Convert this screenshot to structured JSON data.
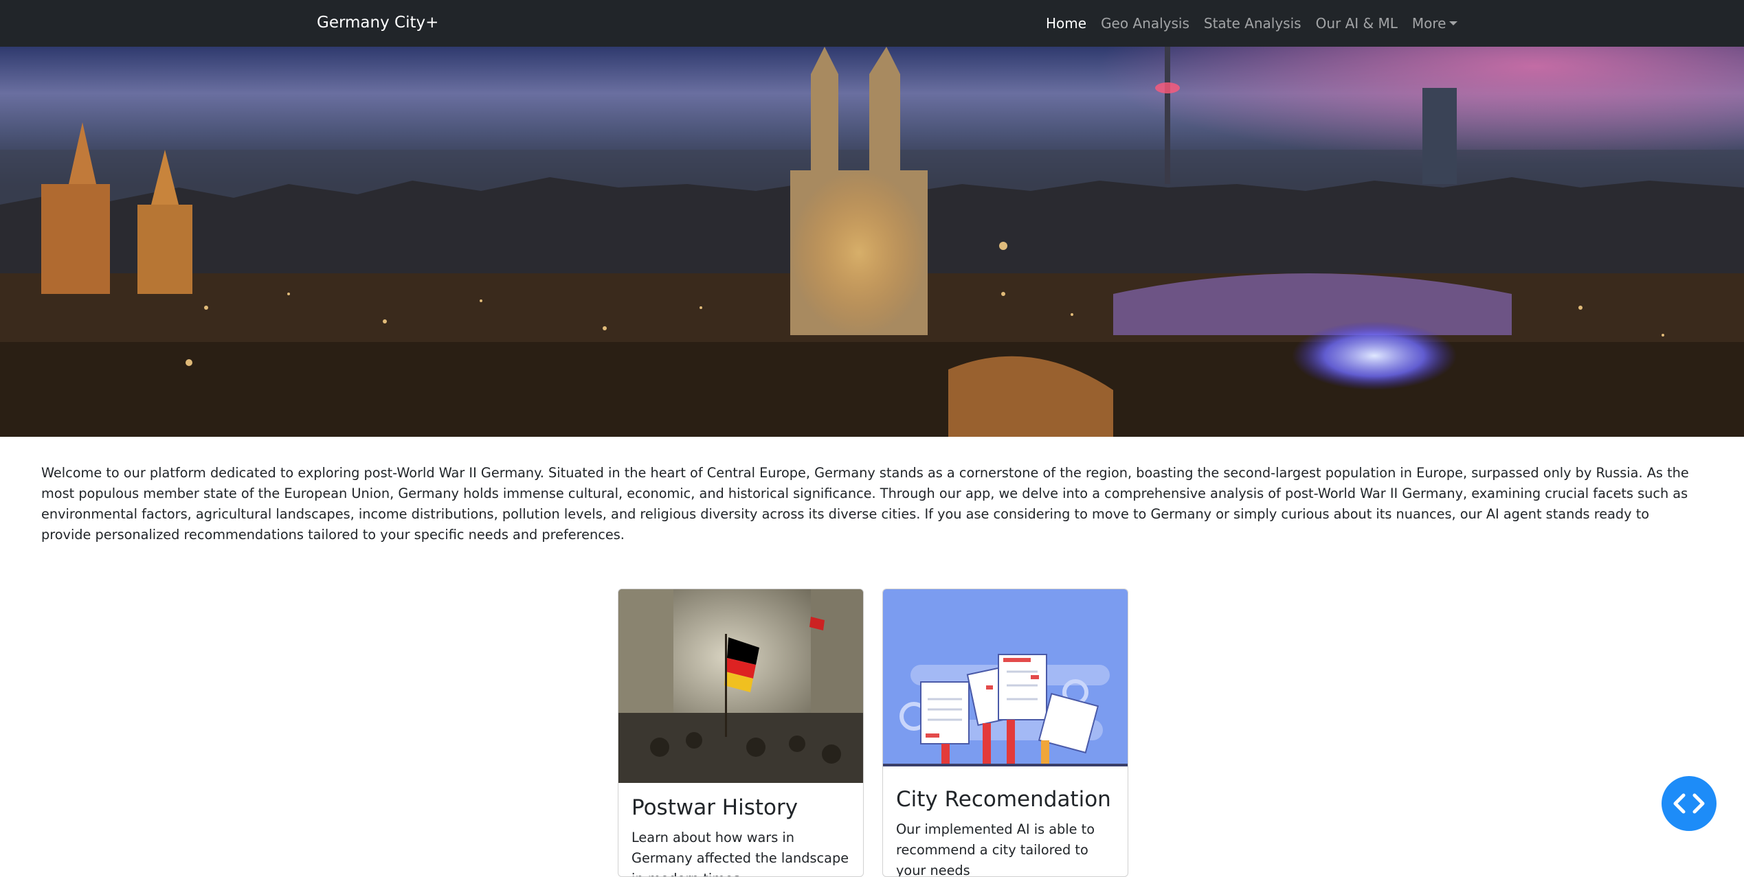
{
  "navbar": {
    "brand": "Germany City+",
    "items": [
      {
        "label": "Home",
        "active": true
      },
      {
        "label": "Geo Analysis",
        "active": false
      },
      {
        "label": "State Analysis",
        "active": false
      },
      {
        "label": "Our AI & ML",
        "active": false
      },
      {
        "label": "More",
        "active": false,
        "dropdown": true
      }
    ]
  },
  "hero": {
    "image": "cologne-night-skyline"
  },
  "intro": {
    "text": "Welcome to our platform dedicated to exploring post-World War II Germany. Situated in the heart of Central Europe, Germany stands as a cornerstone of the region, boasting the second-largest population in Europe, surpassed only by Russia. As the most populous member state of the European Union, Germany holds immense cultural, economic, and historical significance. Through our app, we delve into a comprehensive analysis of post-World War II Germany, examining crucial facets such as environmental factors, agricultural landscapes, income distributions, pollution levels, and religious diversity across its diverse cities. If you ase considering to move to Germany or simply curious about its nuances, our AI agent stands ready to provide personalized recommendations tailored to your specific needs and preferences."
  },
  "cards": [
    {
      "title": "Postwar History",
      "text": "Learn about how wars in Germany affected the landscape in modern times",
      "image": "revolution-painting"
    },
    {
      "title": "City Recomendation",
      "text": "Our implemented AI is able to recommend a city tailored to your needs",
      "image": "checklist-illustration"
    }
  ],
  "fab": {
    "icon": "code-chevrons-icon"
  },
  "colors": {
    "navbar_bg": "#212529",
    "fab_bg": "#1d8cf8",
    "illustration_bg": "#7b9cf0"
  }
}
